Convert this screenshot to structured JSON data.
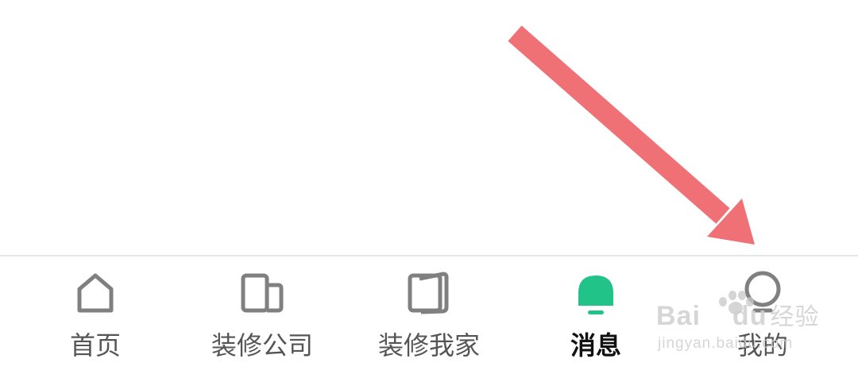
{
  "tabbar": {
    "active_color": "#22c389",
    "inactive_color": "#808080",
    "tabs": [
      {
        "label": "首页",
        "icon": "home-icon"
      },
      {
        "label": "装修公司",
        "icon": "company-icon"
      },
      {
        "label": "装修我家",
        "icon": "book-icon"
      },
      {
        "label": "消息",
        "icon": "bell-icon",
        "active": true
      },
      {
        "label": "我的",
        "icon": "user-icon"
      }
    ]
  },
  "annotation": {
    "arrow_color": "#ef7176",
    "arrow_target": "我的"
  },
  "watermark": {
    "brand": "Bai",
    "brand_suffix": "du",
    "cn": "经验",
    "domain": "jingyan.baidu.com"
  }
}
